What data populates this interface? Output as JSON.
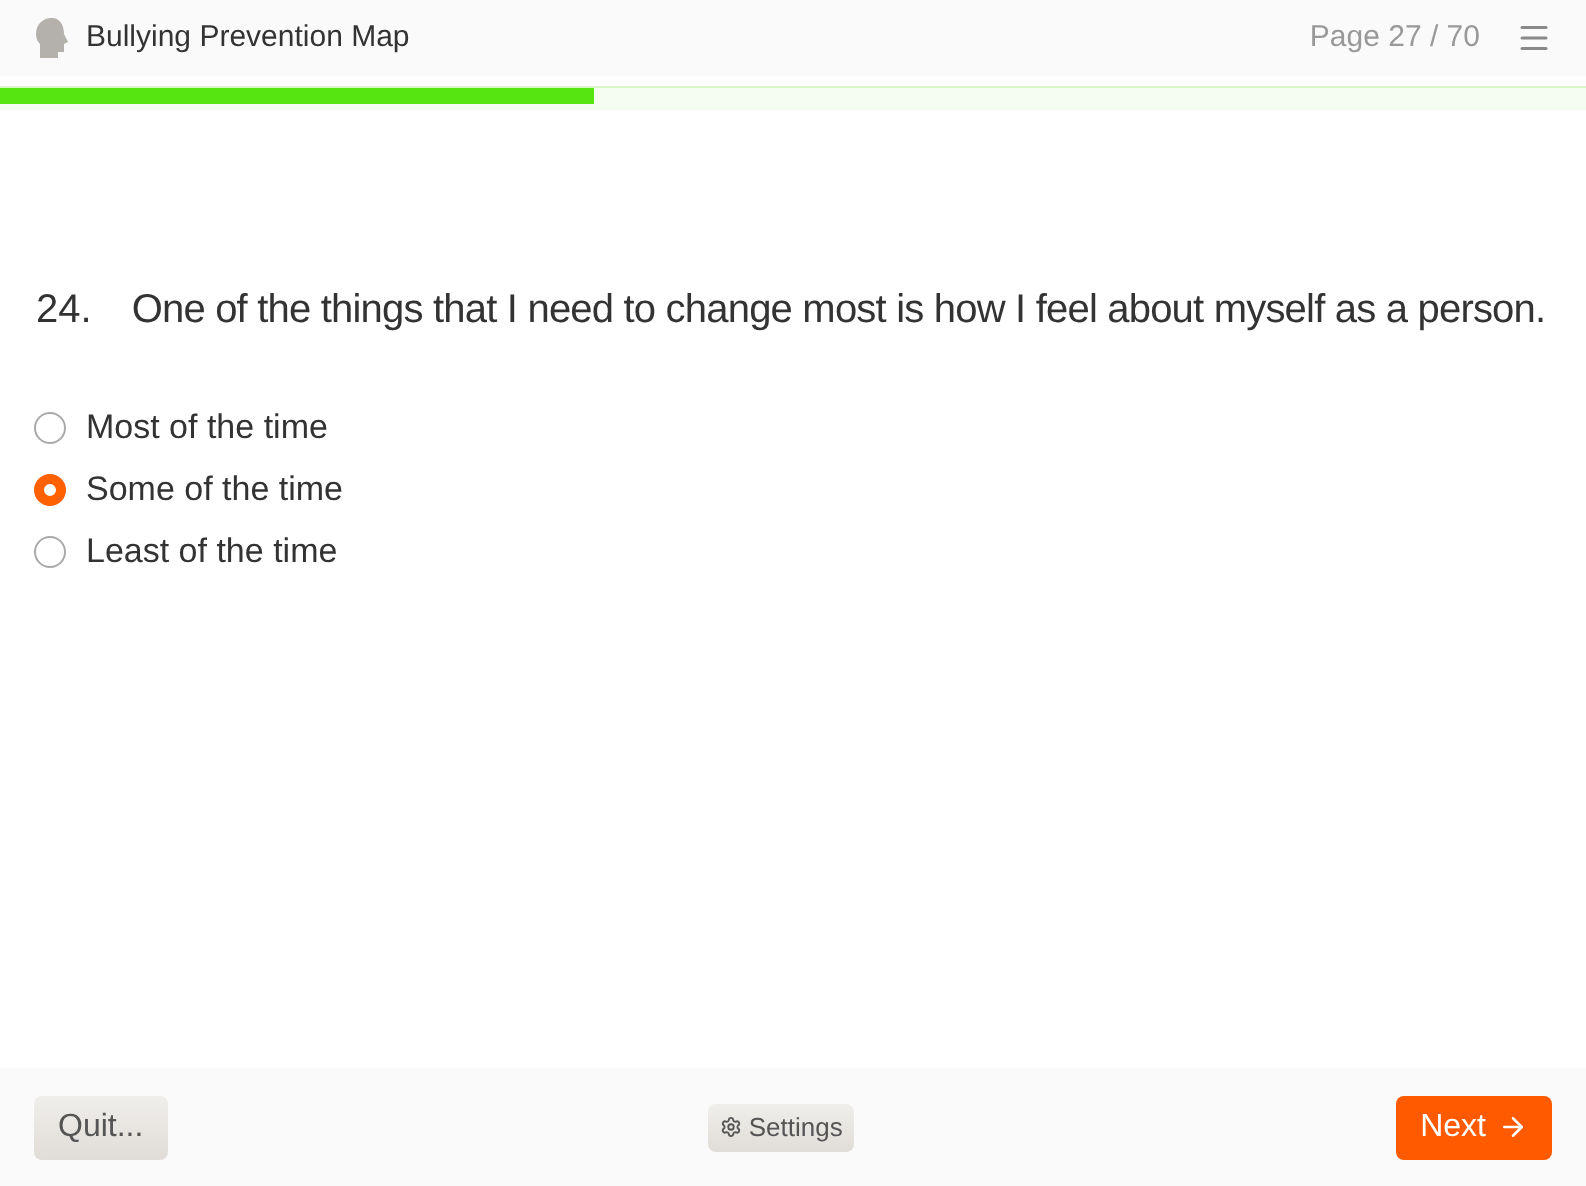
{
  "header": {
    "title": "Bullying Prevention Map",
    "page": "Page 27 / 70"
  },
  "progress": {
    "level": 0.375
  },
  "question": {
    "number": "24.",
    "text": "One of the things that I need to change most is how I feel about myself as a person."
  },
  "options": [
    {
      "label": "Most of the time",
      "selected": false
    },
    {
      "label": "Some of the time",
      "selected": true
    },
    {
      "label": "Least of the time",
      "selected": false
    }
  ],
  "footer": {
    "quit": "Quit...",
    "settings": "Settings",
    "next": "Next"
  }
}
